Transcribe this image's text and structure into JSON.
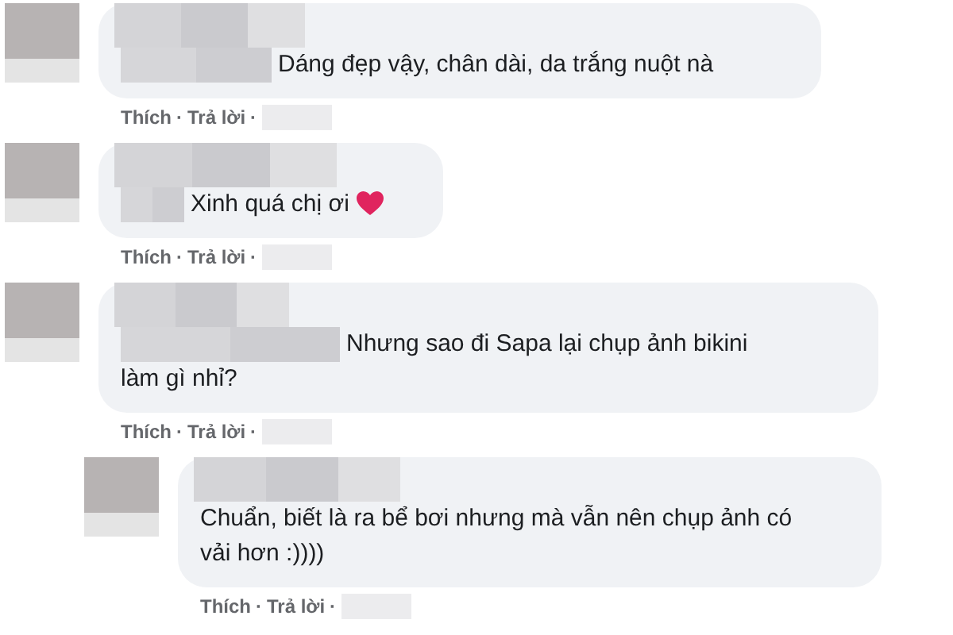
{
  "comments": [
    {
      "text": "Dáng đẹp vậy, chân dài, da trắng nuột nà",
      "heart": false,
      "actions": [
        "Thích",
        "Trả lời"
      ],
      "separator": "·"
    },
    {
      "text": "Xinh quá chị ơi",
      "heart": true,
      "actions": [
        "Thích",
        "Trả lời"
      ],
      "separator": "·"
    },
    {
      "text": "Nhưng sao đi Sapa lại chụp ảnh bikini làm gì nhỉ?",
      "heart": false,
      "actions": [
        "Thích",
        "Trả lời"
      ],
      "separator": "·",
      "replies": [
        {
          "text": "Chuẩn, biết là ra bể bơi nhưng mà vẫn nên chụp ảnh có vải hơn :))))",
          "heart": false,
          "actions": [
            "Thích",
            "Trả lời"
          ],
          "separator": "·"
        }
      ]
    }
  ]
}
